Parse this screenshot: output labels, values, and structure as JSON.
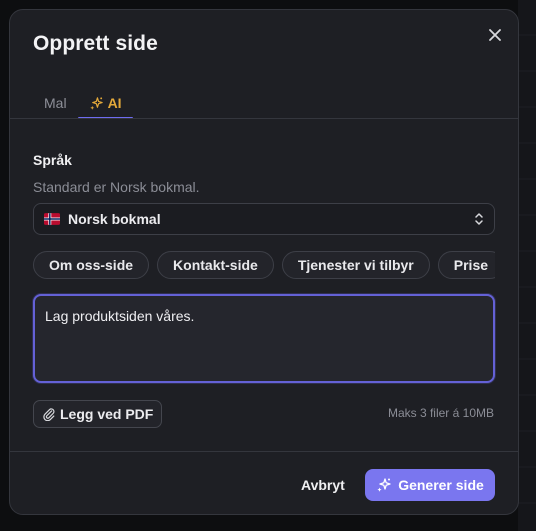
{
  "dialog": {
    "title": "Opprett side",
    "close_icon": "close-icon"
  },
  "tabs": [
    {
      "label": "Mal",
      "active": false
    },
    {
      "label": "AI",
      "active": true,
      "icon": "sparkles-icon"
    }
  ],
  "language": {
    "label": "Språk",
    "hint": "Standard er Norsk bokmal.",
    "selected": "Norsk bokmal",
    "flag_icon": "norway-flag-icon",
    "chevron_icon": "chevron-up-down-icon"
  },
  "suggestions": [
    "Om oss-side",
    "Kontakt-side",
    "Tjenester vi tilbyr",
    "Prise"
  ],
  "prompt": {
    "value": "Lag produktsiden våres."
  },
  "attachment": {
    "label": "Legg ved PDF",
    "icon": "paperclip-icon",
    "limit": "Maks 3 filer á 10MB"
  },
  "footer": {
    "cancel_label": "Avbryt",
    "generate_label": "Generer side",
    "generate_icon": "sparkles-icon"
  },
  "colors": {
    "accent": "#7a76ef",
    "tab_active": "#e4a93a",
    "dialog_bg": "#1e1f24"
  }
}
